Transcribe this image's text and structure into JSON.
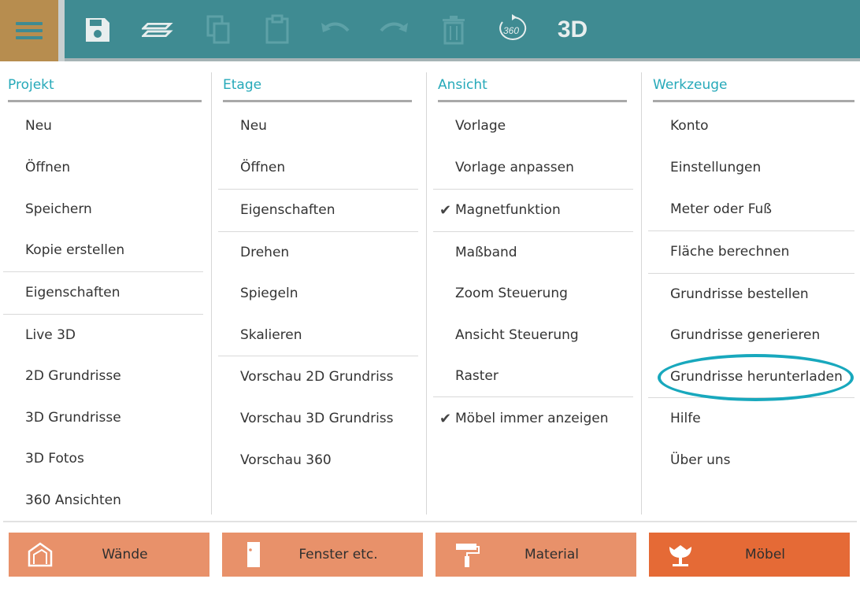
{
  "toolbar": {
    "icons": [
      "menu-icon",
      "save-icon",
      "layers-icon",
      "copy-icon",
      "paste-icon",
      "undo-icon",
      "redo-icon",
      "trash-icon",
      "rotate-360-icon",
      "3d-view-icon"
    ],
    "label_360": "360",
    "label_3d": "3D"
  },
  "columns": {
    "projekt": {
      "title": "Projekt",
      "items": [
        "Neu",
        "Öffnen",
        "Speichern",
        "Kopie erstellen",
        "Eigenschaften",
        "Live 3D",
        "2D Grundrisse",
        "3D Grundrisse",
        "3D Fotos",
        "360 Ansichten"
      ]
    },
    "etage": {
      "title": "Etage",
      "items": [
        "Neu",
        "Öffnen",
        "Eigenschaften",
        "Drehen",
        "Spiegeln",
        "Skalieren",
        "Vorschau 2D Grundriss",
        "Vorschau 3D Grundriss",
        "Vorschau 360"
      ]
    },
    "ansicht": {
      "title": "Ansicht",
      "items": [
        "Vorlage",
        "Vorlage anpassen",
        "Magnetfunktion",
        "Maßband",
        "Zoom Steuerung",
        "Ansicht Steuerung",
        "Raster",
        "Möbel immer anzeigen"
      ],
      "check_mark": "✔"
    },
    "werkzeuge": {
      "title": "Werkzeuge",
      "items": [
        "Konto",
        "Einstellungen",
        "Meter oder Fuß",
        "Fläche berechnen",
        "Grundrisse bestellen",
        "Grundrisse generieren",
        "Grundrisse herunterladen",
        "Hilfe",
        "Über uns"
      ]
    }
  },
  "bottom_buttons": {
    "waende": "Wände",
    "fenster": "Fenster etc.",
    "material": "Material",
    "moebel": "Möbel"
  },
  "colors": {
    "toolbar": "#3f8b92",
    "menu_button": "#b78d4f",
    "accent_title": "#26a9b9",
    "highlight_ring": "#18a8bd",
    "bottom_button": "#e8916a",
    "bottom_button_active": "#e56a36"
  }
}
